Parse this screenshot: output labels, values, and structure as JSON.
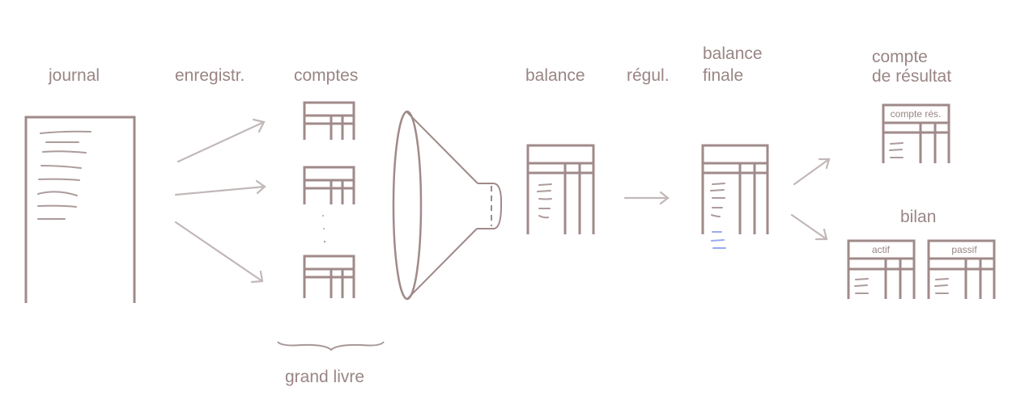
{
  "labels": {
    "journal": "journal",
    "enregistr": "enregistr.",
    "comptes": "comptes",
    "balance": "balance",
    "regul": "régul.",
    "balance_finale_1": "balance",
    "balance_finale_2": "finale",
    "compte_resultat_1": "compte",
    "compte_resultat_2": "de résultat",
    "bilan": "bilan",
    "grand_livre": "grand livre"
  },
  "table_headers": {
    "compte_res": "compte rés.",
    "actif": "actif",
    "passif": "passif"
  },
  "colors": {
    "line": "#a08a8a",
    "text": "#9a8585",
    "arrow": "#c2b8b8",
    "adjustment_entries": "#8fa0ee"
  }
}
